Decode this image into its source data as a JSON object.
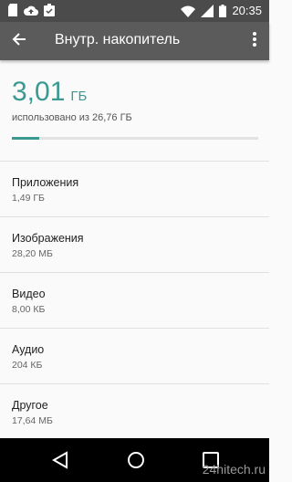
{
  "status_bar": {
    "time": "20:35",
    "left_icons": [
      "sd-card-icon",
      "cloud-upload-icon",
      "clipboard-check-icon"
    ],
    "right_icons": [
      "wifi-icon",
      "signal-icon",
      "battery-icon"
    ]
  },
  "toolbar": {
    "title": "Внутр. накопитель",
    "back_icon": "arrow-back-icon",
    "more_icon": "more-vert-icon"
  },
  "summary": {
    "used_number": "3,01",
    "used_unit": "ГБ",
    "caption": "использовано из 26,76 ГБ",
    "progress_fraction": 0.112,
    "accent_color": "#3a9a92"
  },
  "items": [
    {
      "title": "Приложения",
      "size": "1,49 ГБ"
    },
    {
      "title": "Изображения",
      "size": "28,20 МБ"
    },
    {
      "title": "Видео",
      "size": "8,00 КБ"
    },
    {
      "title": "Аудио",
      "size": "204 КБ"
    },
    {
      "title": "Другое",
      "size": "17,64 МБ"
    }
  ],
  "watermark": "24hitech.ru"
}
